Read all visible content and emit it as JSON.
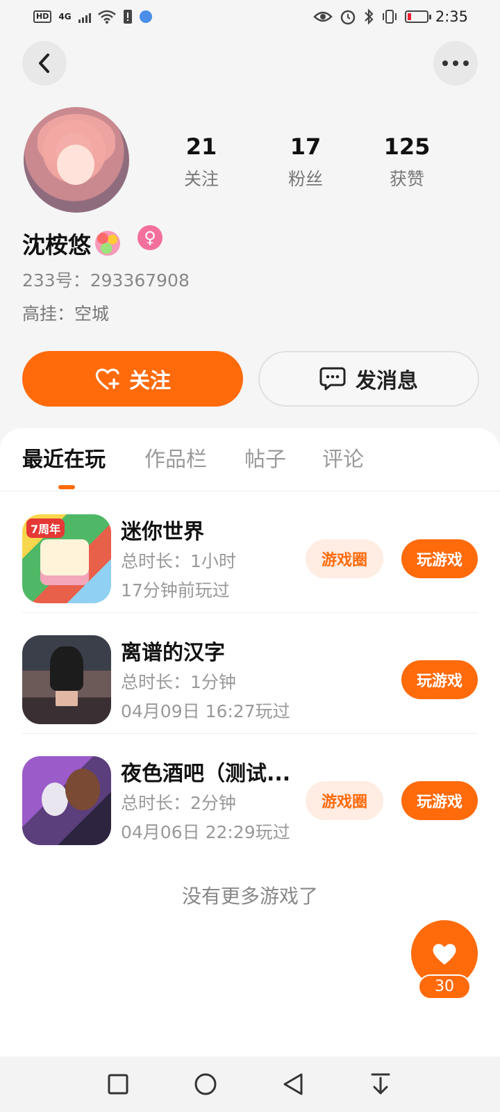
{
  "status_bar": {
    "left_chips": [
      "HD",
      "4G"
    ],
    "time": "2:35",
    "icons": [
      "hd-icon",
      "signal-icon",
      "wifi-icon",
      "alert-icon",
      "globe-icon",
      "eye-icon",
      "alarm-icon",
      "bluetooth-icon",
      "vibrate-icon",
      "battery-icon"
    ]
  },
  "header": {
    "back_icon": "chevron-left-icon",
    "more_icon": "more-horizontal-icon"
  },
  "profile": {
    "username": "沈桉悠",
    "gender_symbol": "♀",
    "uid_text": "233号：293367908",
    "level_text": "高挂：空城",
    "stats": [
      {
        "value": "21",
        "label": "关注"
      },
      {
        "value": "17",
        "label": "粉丝"
      },
      {
        "value": "125",
        "label": "获赞"
      }
    ],
    "follow_label": "关注",
    "message_label": "发消息"
  },
  "tabs": [
    {
      "label": "最近在玩",
      "active": true
    },
    {
      "label": "作品栏",
      "active": false
    },
    {
      "label": "帖子",
      "active": false
    },
    {
      "label": "评论",
      "active": false
    }
  ],
  "games": [
    {
      "title": "迷你世界",
      "duration": "总时长：1小时",
      "last_played": "17分钟前玩过",
      "circle_label": "游戏圈",
      "play_label": "玩游戏",
      "icon_text": "7周年"
    },
    {
      "title": "离谱的汉字",
      "duration": "总时长：1分钟",
      "last_played": "04月09日 16:27玩过",
      "play_label": "玩游戏"
    },
    {
      "title": "夜色酒吧（测试...",
      "duration": "总时长：2分钟",
      "last_played": "04月06日 22:29玩过",
      "circle_label": "游戏圈",
      "play_label": "玩游戏"
    }
  ],
  "no_more_text": "没有更多游戏了",
  "like_count": "30",
  "colors": {
    "accent": "#ff6a0b",
    "accent_light": "#ffece2",
    "gender": "#f36f9c"
  }
}
